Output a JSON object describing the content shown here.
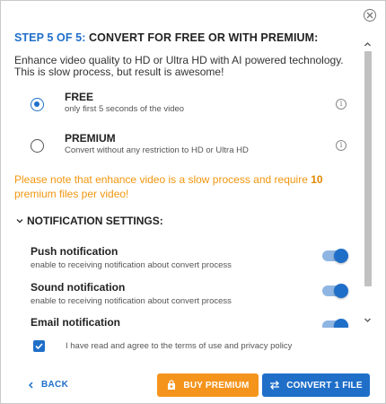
{
  "dialog": {
    "close_icon": "close-circle-icon",
    "step_label": "STEP 5 OF 5:",
    "title": "CONVERT FOR FREE OR WITH PREMIUM:",
    "intro": "Enhance video quality to HD or Ultra HD with AI powered technology. This is slow process, but result is awesome!"
  },
  "options": [
    {
      "title": "FREE",
      "subtitle": "only first 5 seconds of the video",
      "selected": true
    },
    {
      "title": "PREMIUM",
      "subtitle": "Convert without any restriction to HD or Ultra HD",
      "selected": false
    }
  ],
  "warning": {
    "text_before": "Please note that enhance video is a slow process and require ",
    "count": "10",
    "text_after": " premium files per video!"
  },
  "notifications": {
    "header": "NOTIFICATION SETTINGS:",
    "items": [
      {
        "title": "Push notification",
        "subtitle": "enable to receiving notification about convert process",
        "enabled": true
      },
      {
        "title": "Sound notification",
        "subtitle": "enable to receiving notification about convert process",
        "enabled": true
      },
      {
        "title": "Email notification",
        "subtitle": "",
        "enabled": true
      }
    ]
  },
  "agree": {
    "checked": true,
    "text": "I have read and agree to the terms of use and privacy policy"
  },
  "footer": {
    "back_label": "BACK",
    "premium_label": "BUY PREMIUM",
    "convert_label": "CONVERT 1 FILE"
  },
  "colors": {
    "accent": "#1f6fc9",
    "premium": "#f5941d",
    "warning": "#f0960f"
  }
}
